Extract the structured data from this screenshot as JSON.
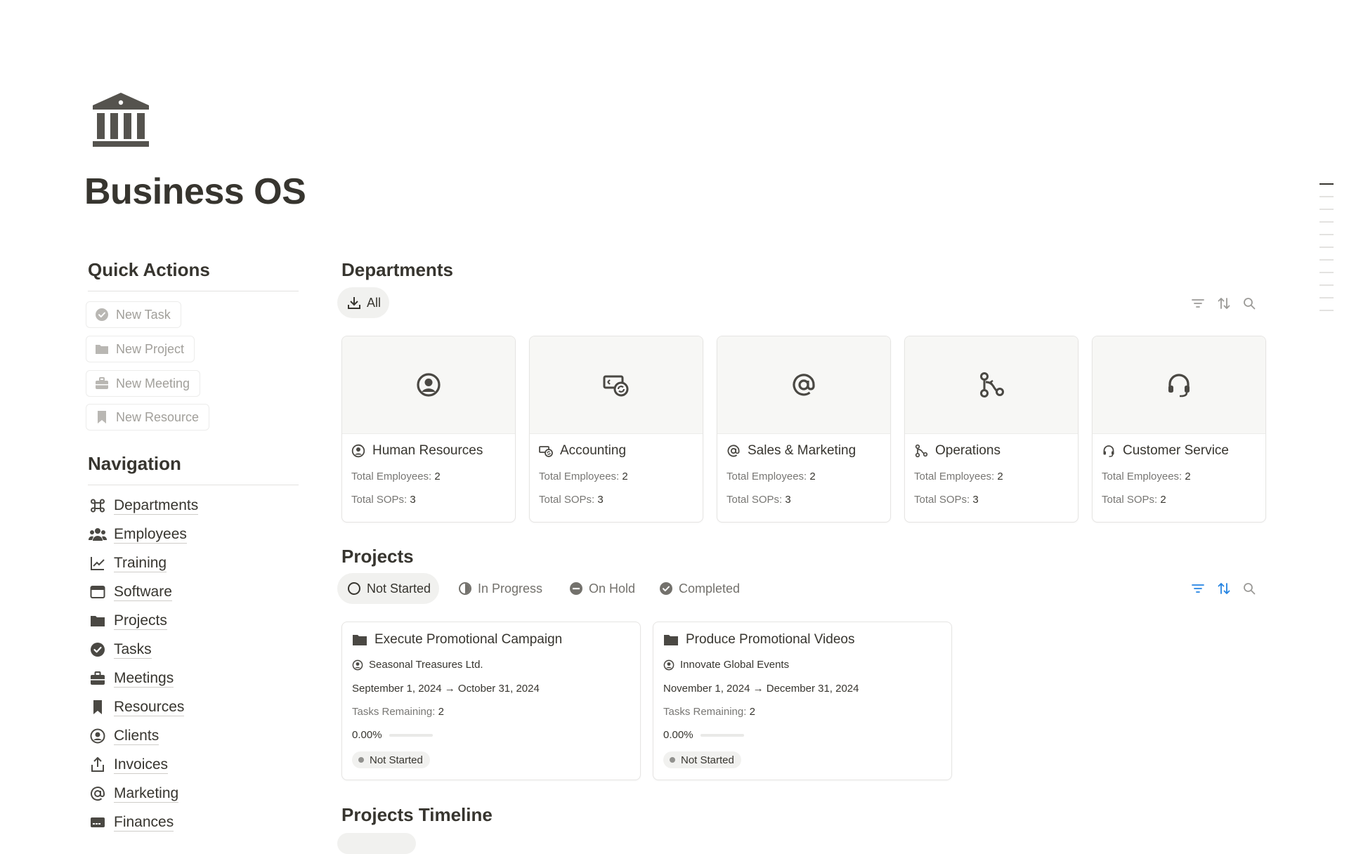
{
  "page": {
    "title": "Business OS",
    "icon": "bank-icon"
  },
  "quick_actions": {
    "title": "Quick Actions",
    "buttons": [
      {
        "label": "New Task",
        "icon": "check-circle-icon"
      },
      {
        "label": "New Project",
        "icon": "folder-icon"
      },
      {
        "label": "New Meeting",
        "icon": "briefcase-icon"
      },
      {
        "label": "New Resource",
        "icon": "bookmark-icon"
      }
    ]
  },
  "navigation": {
    "title": "Navigation",
    "items": [
      {
        "label": "Departments",
        "icon": "command-icon"
      },
      {
        "label": "Employees",
        "icon": "people-icon"
      },
      {
        "label": "Training",
        "icon": "chart-line-icon"
      },
      {
        "label": "Software",
        "icon": "browser-window-icon"
      },
      {
        "label": "Projects",
        "icon": "folder-icon"
      },
      {
        "label": "Tasks",
        "icon": "check-circle-icon"
      },
      {
        "label": "Meetings",
        "icon": "briefcase-icon"
      },
      {
        "label": "Resources",
        "icon": "bookmark-icon"
      },
      {
        "label": "Clients",
        "icon": "user-circle-icon"
      },
      {
        "label": "Invoices",
        "icon": "share-upload-icon"
      },
      {
        "label": "Marketing",
        "icon": "at-sign-icon"
      },
      {
        "label": "Finances",
        "icon": "credit-card-icon"
      }
    ]
  },
  "departments": {
    "title": "Departments",
    "view_tab": "All",
    "label_employees": "Total Employees: ",
    "label_sops": "Total SOPs: ",
    "cards": [
      {
        "name": "Human Resources",
        "icon": "user-circle-icon",
        "employees": "2",
        "sops": "3"
      },
      {
        "name": "Accounting",
        "icon": "money-exchange-icon",
        "employees": "2",
        "sops": "3"
      },
      {
        "name": "Sales & Marketing",
        "icon": "at-sign-icon",
        "employees": "2",
        "sops": "3"
      },
      {
        "name": "Operations",
        "icon": "route-icon",
        "employees": "2",
        "sops": "3"
      },
      {
        "name": "Customer Service",
        "icon": "headset-icon",
        "employees": "2",
        "sops": "2"
      }
    ]
  },
  "projects": {
    "title": "Projects",
    "tabs": [
      {
        "label": "Not Started",
        "icon": "circle-outline-icon",
        "active": true
      },
      {
        "label": "In Progress",
        "icon": "half-circle-icon",
        "active": false
      },
      {
        "label": "On Hold",
        "icon": "minus-circle-icon",
        "active": false
      },
      {
        "label": "Completed",
        "icon": "check-circle-icon",
        "active": false
      }
    ],
    "label_tasks": "Tasks Remaining: ",
    "cards": [
      {
        "name": "Execute Promotional Campaign",
        "client": "Seasonal Treasures Ltd.",
        "dates": "September 1, 2024 → October 31, 2024",
        "tasks_remaining": "2",
        "progress_label": "0.00%",
        "progress": 0,
        "status": "Not Started"
      },
      {
        "name": "Produce Promotional Videos",
        "client": "Innovate Global Events",
        "dates": "November 1, 2024 → December 31, 2024",
        "tasks_remaining": "2",
        "progress_label": "0.00%",
        "progress": 0,
        "status": "Not Started"
      }
    ]
  },
  "timeline": {
    "title": "Projects Timeline"
  },
  "colors": {
    "text": "#37352f",
    "muted": "#787774",
    "accent": "#2383e2",
    "icon": "#4a4843"
  }
}
